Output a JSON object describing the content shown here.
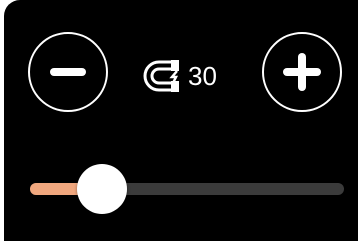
{
  "control": {
    "value": "30",
    "value_icon": "magnet-icon",
    "minus_icon": "minus-icon",
    "plus_icon": "plus-icon"
  },
  "slider": {
    "level": 0.23
  },
  "colors": {
    "panel_background": "#000000",
    "foreground": "#ffffff",
    "slider_fill": "#f0a77e",
    "slider_track": "#3b3b3b",
    "thumb": "#ffffff"
  }
}
